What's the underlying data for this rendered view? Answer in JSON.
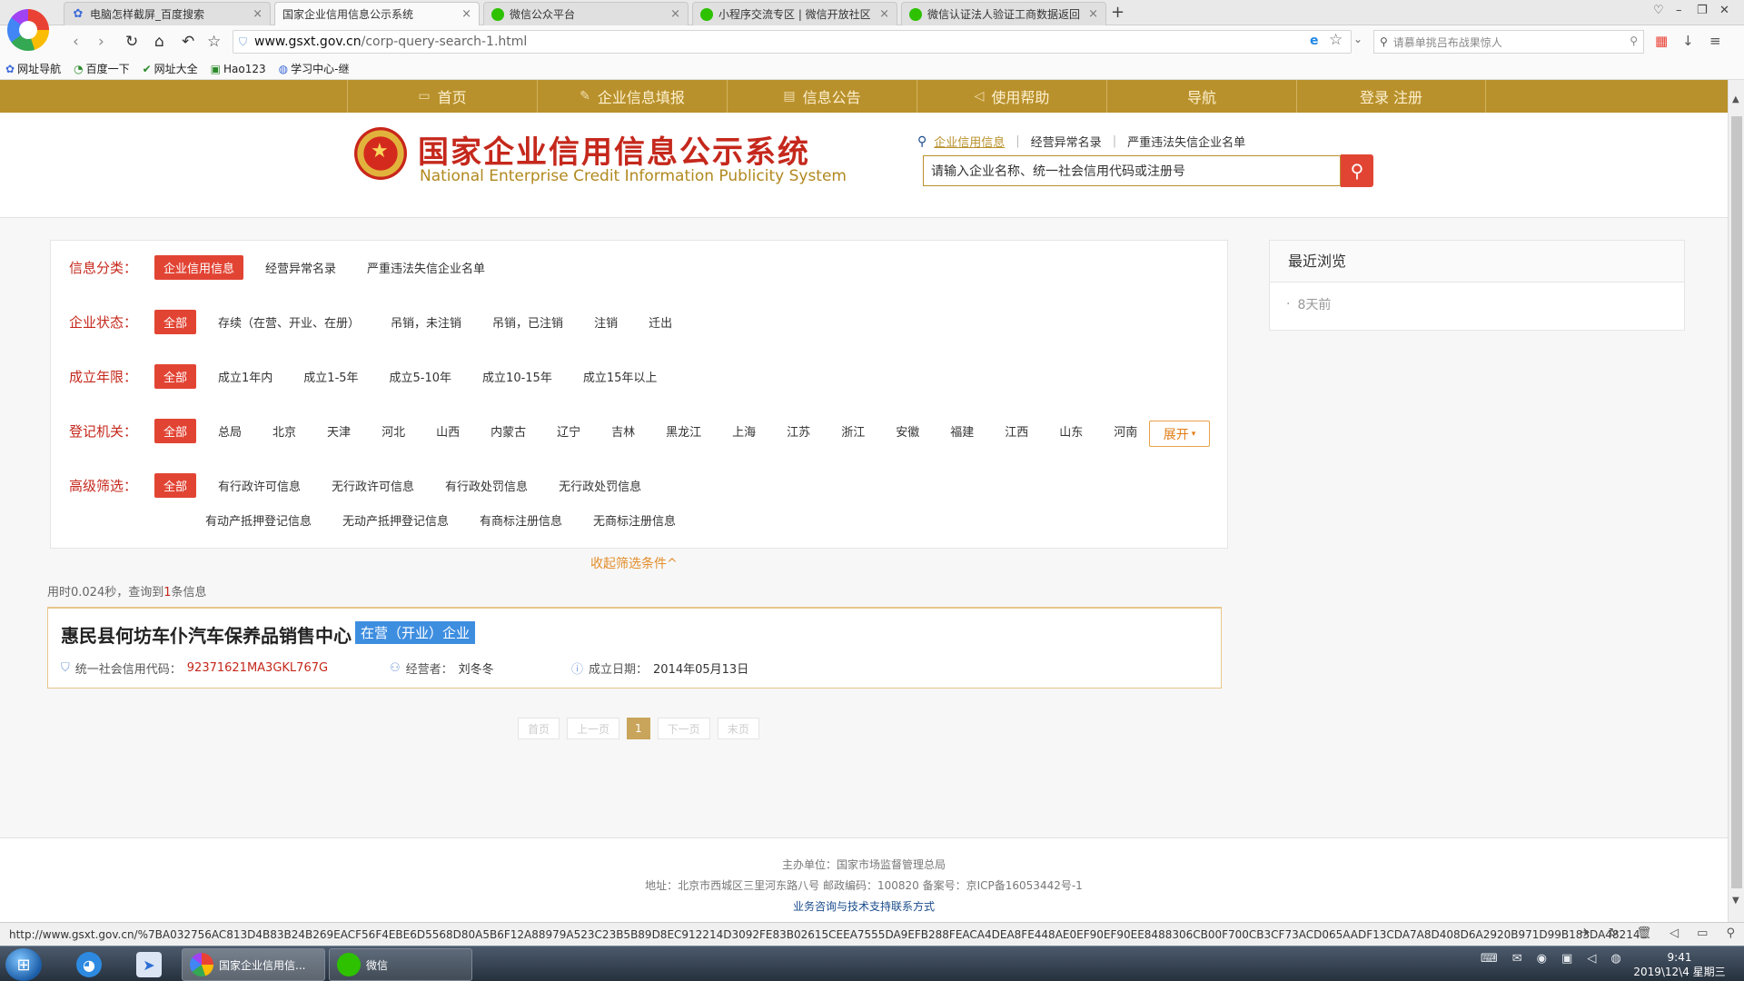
{
  "browser": {
    "tabs": [
      {
        "title": "电脑怎样截屏_百度搜索",
        "icon": "paw-icon"
      },
      {
        "title": "国家企业信用信息公示系统",
        "icon": "page-icon"
      },
      {
        "title": "微信公众平台",
        "icon": "wechat-icon"
      },
      {
        "title": "小程序交流专区 | 微信开放社区",
        "icon": "wechat-icon"
      },
      {
        "title": "微信认证法人验证工商数据返回",
        "icon": "wechat-icon"
      }
    ],
    "url_host": "www.gsxt.gov.cn",
    "url_path": "/corp-query-search-1.html",
    "search_placeholder": "请慕单挑吕布战果惊人",
    "bookmarks": [
      {
        "label": "网址导航",
        "icon": "paw-icon"
      },
      {
        "label": "百度一下",
        "icon": "baidu-icon"
      },
      {
        "label": "网址大全",
        "icon": "bookmark-icon"
      },
      {
        "label": "Hao123",
        "icon": "hao123-icon"
      },
      {
        "label": "学习中心-继",
        "icon": "globe-icon"
      }
    ],
    "status_url": "http://www.gsxt.gov.cn/%7BA032756AC813D4B83B24B269EACF56F4EBE6D5568D80A5B6F12A88979A523C23B5B89D8EC912214D3092FE83B02615CEEA7555DA9EFB288FEACA4DEA8FE448AE0EF90EF90EE8488306CB00F700CB3CF73ACD065AADF13CDA7A8D408D6A2920B971D99B183DA48214..."
  },
  "site": {
    "nav": [
      "首页",
      "企业信息填报",
      "信息公告",
      "使用帮助",
      "导航",
      "登录  注册"
    ],
    "title_cn": "国家企业信用信息公示系统",
    "title_en": "National Enterprise Credit Information Publicity System",
    "header_tabs": [
      "企业信用信息",
      "经营异常名录",
      "严重违法失信企业名单"
    ],
    "search_placeholder": "请输入企业名称、统一社会信用代码或注册号"
  },
  "filters": {
    "category": {
      "label": "信息分类：",
      "options": [
        "企业信用信息",
        "经营异常名录",
        "严重违法失信企业名单"
      ]
    },
    "status": {
      "label": "企业状态：",
      "options": [
        "全部",
        "存续（在营、开业、在册）",
        "吊销，未注销",
        "吊销，已注销",
        "注销",
        "迁出"
      ]
    },
    "age": {
      "label": "成立年限：",
      "options": [
        "全部",
        "成立1年内",
        "成立1-5年",
        "成立5-10年",
        "成立10-15年",
        "成立15年以上"
      ]
    },
    "authority": {
      "label": "登记机关：",
      "options": [
        "全部",
        "总局",
        "北京",
        "天津",
        "河北",
        "山西",
        "内蒙古",
        "辽宁",
        "吉林",
        "黑龙江",
        "上海",
        "江苏",
        "浙江",
        "安徽",
        "福建",
        "江西",
        "山东",
        "河南"
      ]
    },
    "advanced": {
      "label": "高级筛选：",
      "options_row1": [
        "全部",
        "有行政许可信息",
        "无行政许可信息",
        "有行政处罚信息",
        "无行政处罚信息"
      ],
      "options_row2": [
        "有动产抵押登记信息",
        "无动产抵押登记信息",
        "有商标注册信息",
        "无商标注册信息"
      ]
    },
    "expand_label": "展开",
    "collapse_label": "收起筛选条件^"
  },
  "results": {
    "meta_prefix": "用时0.024秒，查询到",
    "meta_count": "1",
    "meta_suffix": "条信息",
    "items": [
      {
        "name": "惠民县何坊车仆汽车保养品销售中心",
        "badge": "在营（开业）企业",
        "credit_label": "统一社会信用代码：",
        "credit_code": "92371621MA3GKL767G",
        "operator_label": "经营者：",
        "operator": "刘冬冬",
        "date_label": "成立日期：",
        "date": "2014年05月13日"
      }
    ],
    "pager": [
      "首页",
      "上一页",
      "1",
      "下一页",
      "末页"
    ]
  },
  "recent": {
    "title": "最近浏览",
    "items": [
      "8天前"
    ]
  },
  "footer": {
    "line1": "主办单位：国家市场监督管理总局",
    "line2": "地址：北京市西城区三里河东路八号   邮政编码：100820   备案号：京ICP备16053442号-1",
    "line3": "业务咨询与技术支持联系方式"
  },
  "taskbar": {
    "tasks": [
      "国家企业信用信...",
      "微信"
    ],
    "time": "9:41",
    "date": "2019\\12\\4 星期三"
  }
}
